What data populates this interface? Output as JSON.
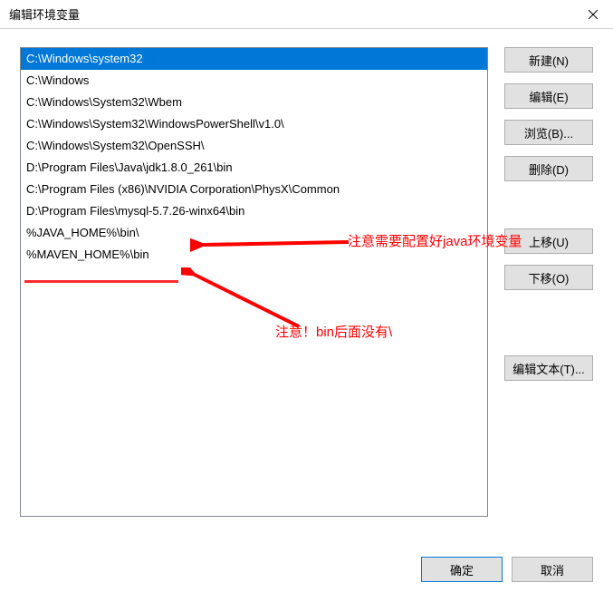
{
  "title": "编辑环境变量",
  "list_items": [
    "C:\\Windows\\system32",
    "C:\\Windows",
    "C:\\Windows\\System32\\Wbem",
    "C:\\Windows\\System32\\WindowsPowerShell\\v1.0\\",
    "C:\\Windows\\System32\\OpenSSH\\",
    "D:\\Program Files\\Java\\jdk1.8.0_261\\bin",
    "C:\\Program Files (x86)\\NVIDIA Corporation\\PhysX\\Common",
    "D:\\Program Files\\mysql-5.7.26-winx64\\bin",
    "%JAVA_HOME%\\bin\\",
    "%MAVEN_HOME%\\bin"
  ],
  "selected_index": 0,
  "buttons": {
    "new": "新建(N)",
    "edit": "编辑(E)",
    "browse": "浏览(B)...",
    "delete": "删除(D)",
    "move_up": "上移(U)",
    "move_down": "下移(O)",
    "edit_text": "编辑文本(T)...",
    "ok": "确定",
    "cancel": "取消"
  },
  "annotations": {
    "note1": "注意需要配置好java环境变量",
    "note2": "注意！bin后面没有\\"
  }
}
